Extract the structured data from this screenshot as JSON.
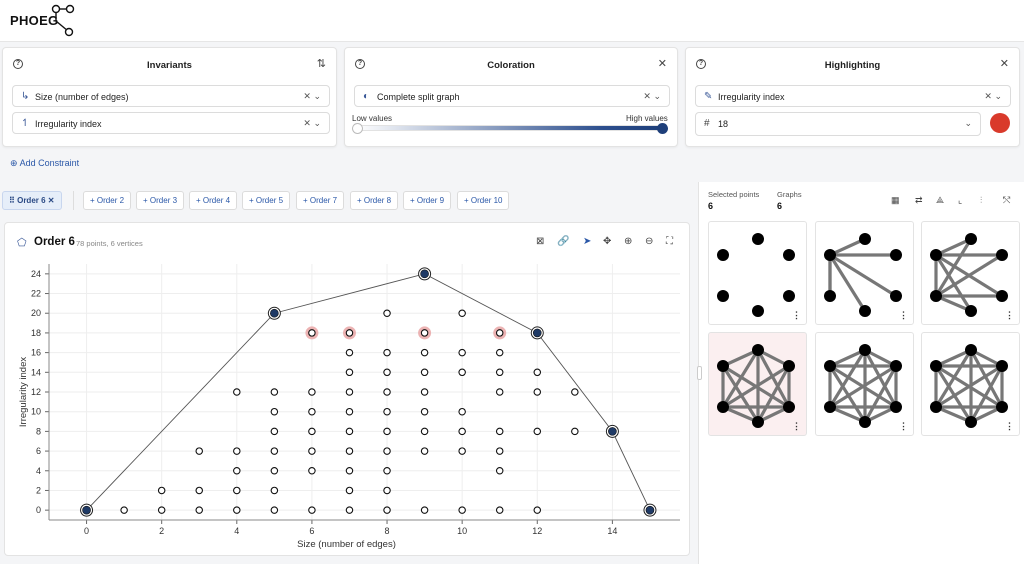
{
  "app": {
    "logo": "PHOEG"
  },
  "invariants": {
    "title": "Invariants",
    "fields": [
      {
        "label": "Size (number of edges)"
      },
      {
        "label": "Irregularity index"
      }
    ]
  },
  "coloration": {
    "title": "Coloration",
    "field_label": "Complete split graph",
    "low_label": "Low values",
    "high_label": "High values",
    "gradient_colors": [
      "#ffffff",
      "#1e3f7a"
    ]
  },
  "highlighting": {
    "title": "Highlighting",
    "field_label": "Irregularity index",
    "value": "18",
    "color": "#d93a2b"
  },
  "add_constraint": "Add Constraint",
  "tabs": [
    {
      "label": "Order 6"
    },
    {
      "label": "Order 2"
    },
    {
      "label": "Order 3"
    },
    {
      "label": "Order 4"
    },
    {
      "label": "Order 5"
    },
    {
      "label": "Order 7"
    },
    {
      "label": "Order 8"
    },
    {
      "label": "Order 9"
    },
    {
      "label": "Order 10"
    }
  ],
  "plot": {
    "title": "Order 6",
    "subtitle": "78 points, 6 vertices"
  },
  "side_panel": {
    "selected_label": "Selected points",
    "selected_value": "6",
    "graphs_label": "Graphs",
    "graphs_value": "6"
  },
  "chart_data": {
    "type": "scatter",
    "xlabel": "Size (number of edges)",
    "ylabel": "Irregularity index",
    "xlim": [
      0,
      15
    ],
    "ylim": [
      0,
      24
    ],
    "xticks": [
      0,
      2,
      4,
      6,
      8,
      10,
      12,
      14
    ],
    "yticks": [
      0,
      2,
      4,
      6,
      8,
      10,
      12,
      14,
      16,
      18,
      20,
      22,
      24
    ],
    "grid": true,
    "points": [
      [
        0,
        0
      ],
      [
        1,
        0
      ],
      [
        2,
        0
      ],
      [
        3,
        0
      ],
      [
        4,
        0
      ],
      [
        5,
        0
      ],
      [
        6,
        0
      ],
      [
        7,
        0
      ],
      [
        8,
        0
      ],
      [
        9,
        0
      ],
      [
        10,
        0
      ],
      [
        11,
        0
      ],
      [
        12,
        0
      ],
      [
        15,
        0
      ],
      [
        2,
        2
      ],
      [
        3,
        2
      ],
      [
        4,
        2
      ],
      [
        5,
        2
      ],
      [
        7,
        2
      ],
      [
        8,
        2
      ],
      [
        4,
        4
      ],
      [
        5,
        4
      ],
      [
        6,
        4
      ],
      [
        7,
        4
      ],
      [
        8,
        4
      ],
      [
        11,
        4
      ],
      [
        3,
        6
      ],
      [
        4,
        6
      ],
      [
        5,
        6
      ],
      [
        6,
        6
      ],
      [
        7,
        6
      ],
      [
        8,
        6
      ],
      [
        9,
        6
      ],
      [
        10,
        6
      ],
      [
        11,
        6
      ],
      [
        5,
        8
      ],
      [
        6,
        8
      ],
      [
        7,
        8
      ],
      [
        8,
        8
      ],
      [
        9,
        8
      ],
      [
        10,
        8
      ],
      [
        11,
        8
      ],
      [
        12,
        8
      ],
      [
        13,
        8
      ],
      [
        14,
        8
      ],
      [
        5,
        10
      ],
      [
        6,
        10
      ],
      [
        7,
        10
      ],
      [
        8,
        10
      ],
      [
        9,
        10
      ],
      [
        10,
        10
      ],
      [
        4,
        12
      ],
      [
        5,
        12
      ],
      [
        6,
        12
      ],
      [
        7,
        12
      ],
      [
        8,
        12
      ],
      [
        9,
        12
      ],
      [
        11,
        12
      ],
      [
        12,
        12
      ],
      [
        13,
        12
      ],
      [
        7,
        14
      ],
      [
        8,
        14
      ],
      [
        9,
        14
      ],
      [
        10,
        14
      ],
      [
        11,
        14
      ],
      [
        12,
        14
      ],
      [
        7,
        16
      ],
      [
        8,
        16
      ],
      [
        9,
        16
      ],
      [
        10,
        16
      ],
      [
        11,
        16
      ],
      [
        6,
        18
      ],
      [
        7,
        18
      ],
      [
        9,
        18
      ],
      [
        11,
        18
      ],
      [
        12,
        18
      ],
      [
        5,
        20
      ],
      [
        8,
        20
      ],
      [
        10,
        20
      ],
      [
        9,
        24
      ]
    ],
    "highlighted": [
      [
        6,
        18
      ],
      [
        7,
        18
      ],
      [
        9,
        18
      ],
      [
        11,
        18
      ]
    ],
    "hull": [
      [
        0,
        0
      ],
      [
        5,
        20
      ],
      [
        9,
        24
      ],
      [
        12,
        18
      ],
      [
        14,
        8
      ],
      [
        15,
        0
      ]
    ],
    "highlight_color": "#e9a6a6",
    "hull_point_color": "#1f3a66"
  }
}
